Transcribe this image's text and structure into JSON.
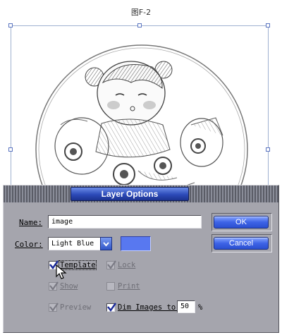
{
  "figure_label": "图F-2",
  "dialog": {
    "title": "Layer Options",
    "name_label": "Name:",
    "name_value": "image",
    "color_label": "Color:",
    "color_value": "Light Blue",
    "swatch_color": "#5878f0",
    "ok_label": "OK",
    "cancel_label": "Cancel",
    "options": {
      "template": {
        "label": "Template",
        "checked": true,
        "enabled": true
      },
      "lock": {
        "label": "Lock",
        "checked": true,
        "enabled": false
      },
      "show": {
        "label": "Show",
        "checked": true,
        "enabled": false
      },
      "print": {
        "label": "Print",
        "checked": false,
        "enabled": false
      },
      "preview": {
        "label": "Preview",
        "checked": true,
        "enabled": false
      },
      "dim_images": {
        "label": "Dim Images to:",
        "checked": true,
        "enabled": true
      }
    },
    "dim_value": "50",
    "dim_unit": "%"
  },
  "colors": {
    "accent": "#3d63e6",
    "dialog_bg": "#a5a5ad"
  }
}
